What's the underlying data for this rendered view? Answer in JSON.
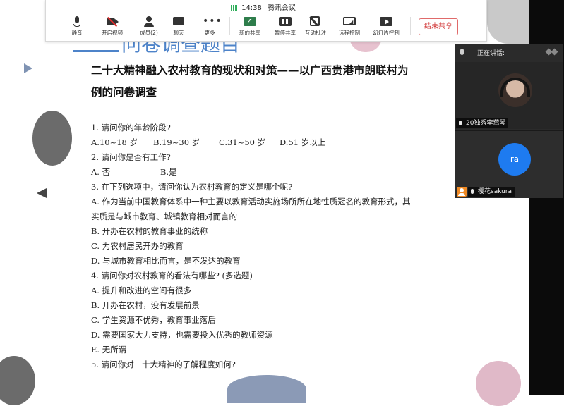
{
  "meeting": {
    "app_name": "腾讯会议",
    "time": "14:38",
    "toolbar": {
      "mute": "静音",
      "start_video": "开启视频",
      "members": "成员(2)",
      "chat": "聊天",
      "more": "更多",
      "new_share": "新的共享",
      "pause_share": "暂停共享",
      "annotate": "互动批注",
      "remote_control": "远程控制",
      "slide_control": "幻灯片控制",
      "end_share": "结束共享"
    },
    "panel": {
      "speaking_label": "正在讲话:",
      "participants": [
        {
          "name": "20独秀李燕琴",
          "avatar": "photo"
        },
        {
          "name": "樱花sakura",
          "avatar_initials": "ra",
          "avatar_color": "#1e7bf0"
        }
      ]
    }
  },
  "slide": {
    "heading": "问卷调查题目",
    "title_line1": "二十大精神融入农村教育的现状和对策——以广西贵港市朗联村为",
    "title_line2": "例的问卷调查",
    "questions": [
      {
        "q": "1.  请问你的年龄阶段?",
        "options": [
          "A.10~18 岁",
          "B.19~30 岁",
          "C.31~50 岁",
          "D.51 岁以上"
        ]
      },
      {
        "q": "2.  请问你是否有工作?",
        "options": [
          "A.  否",
          "B.是"
        ]
      },
      {
        "q": "3.  在下列选项中，请问你认为农村教育的定义是哪个呢?",
        "options": [
          "A.  作为当前中国教育体系中一种主要以教育活动实施场所所在地性质冠名的教育形式，其",
          "实质是与城市教育、城镇教育相对而言的",
          "B.  开办在农村的教育事业的统称",
          "C.  为农村居民开办的教育",
          "D.  与城市教育相比而言，是不发达的教育"
        ]
      },
      {
        "q": "4.  请问你对农村教育的看法有哪些?  (多选题)",
        "options": [
          "A.  提升和改进的空间有很多",
          "B.  开办在农村，没有发展前景",
          "C.  学生资源不优秀，教育事业落后",
          "D.  需要国家大力支持，也需要投入优秀的教师资源",
          "E.  无所谓"
        ]
      },
      {
        "q": "5.  请问你对二十大精神的了解程度如何?"
      }
    ]
  }
}
